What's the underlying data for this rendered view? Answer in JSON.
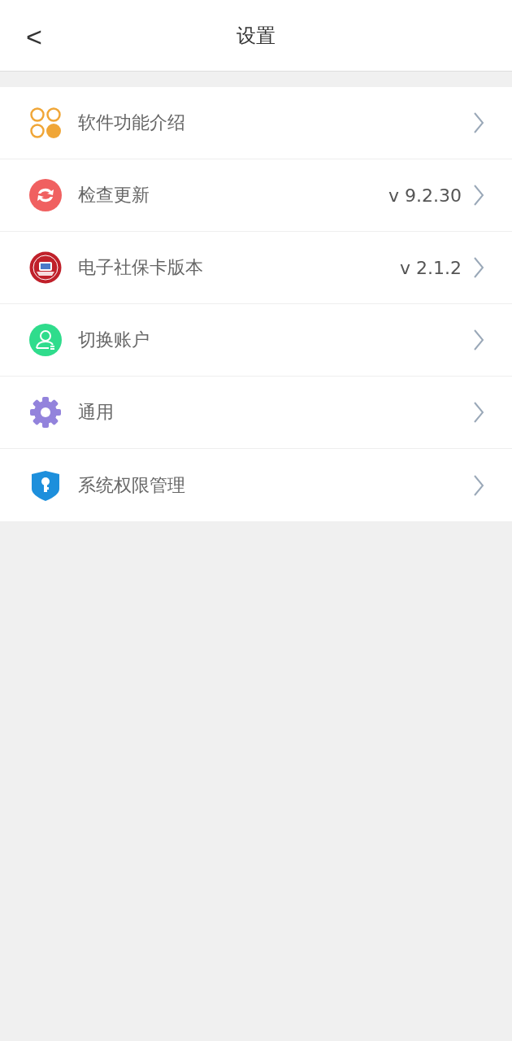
{
  "header": {
    "back": "<",
    "title": "设置"
  },
  "items": [
    {
      "kind": "grid",
      "label": "软件功能介绍"
    },
    {
      "kind": "refresh",
      "label": "检查更新",
      "value": "v 9.2.30"
    },
    {
      "kind": "badge",
      "label": "电子社保卡版本",
      "value": "v 2.1.2"
    },
    {
      "kind": "user",
      "label": "切换账户"
    },
    {
      "kind": "gear",
      "label": "通用"
    },
    {
      "kind": "shield",
      "label": "系统权限管理"
    }
  ]
}
